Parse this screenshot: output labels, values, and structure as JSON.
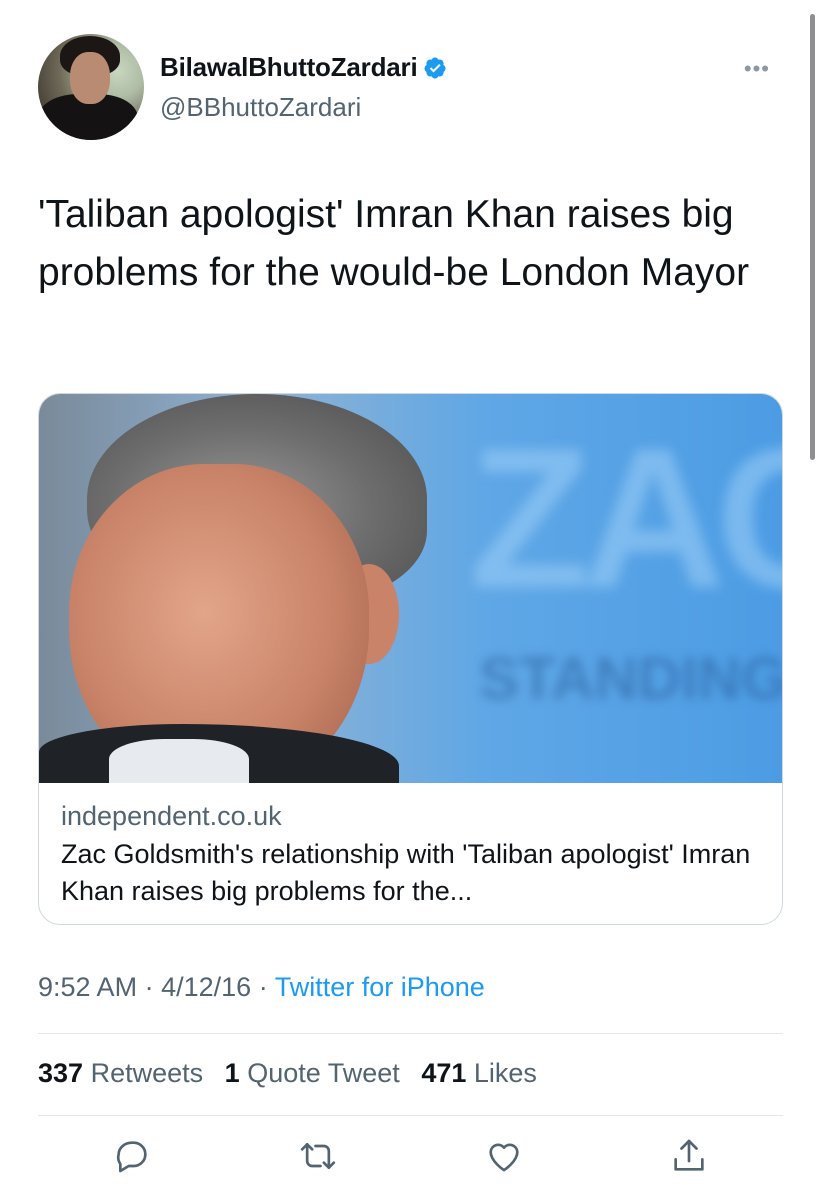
{
  "tweet": {
    "author": {
      "display_name": "BilawalBhuttoZardari",
      "handle": "@BBhuttoZardari",
      "verified": true,
      "avatar_icon": "profile-photo"
    },
    "more_icon": "more-horizontal-icon",
    "text": "'Taliban apologist' Imran Khan raises big problems for the would-be London Mayor",
    "card": {
      "domain": "independent.co.uk",
      "title": "Zac Goldsmith's relationship with 'Taliban apologist' Imran Khan raises big problems for the...",
      "bg_text": "ZAC",
      "bg_text2": "STANDING"
    },
    "meta": {
      "time": "9:52 AM",
      "separator": "·",
      "date": "4/12/16",
      "source": "Twitter for iPhone"
    },
    "stats": {
      "retweets_count": "337",
      "retweets_label": "Retweets",
      "quotes_count": "1",
      "quotes_label": "Quote Tweet",
      "likes_count": "471",
      "likes_label": "Likes"
    },
    "actions": [
      "reply-icon",
      "retweet-icon",
      "like-icon",
      "share-icon"
    ]
  },
  "colors": {
    "link": "#1d9bf0",
    "secondary_text": "#536471",
    "primary_text": "#0f1419",
    "border": "#cfd9de"
  }
}
